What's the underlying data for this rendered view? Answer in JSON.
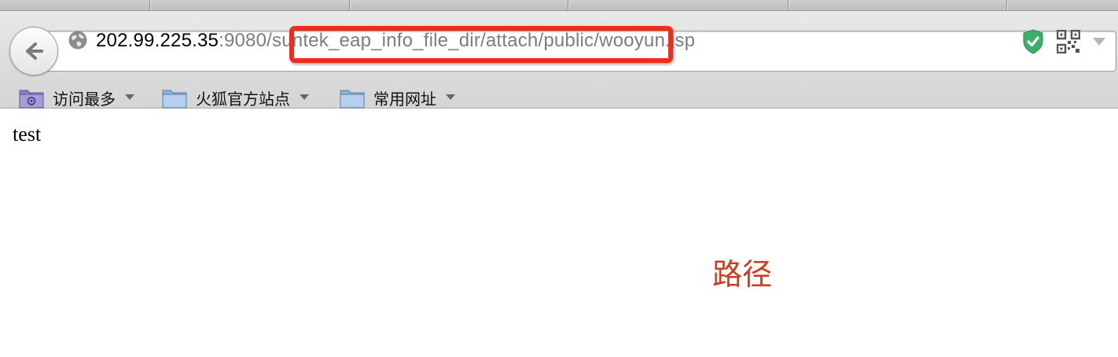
{
  "browser": {
    "url": {
      "host": "202.99.225.35",
      "rest": ":9080/suntek_eap_info_file_dir/attach/public/wooyun.jsp"
    },
    "bookmarks": [
      {
        "label": "访问最多",
        "icon": "smart-folder-icon"
      },
      {
        "label": "火狐官方站点",
        "icon": "folder-icon"
      },
      {
        "label": "常用网址",
        "icon": "folder-icon"
      }
    ],
    "icons": {
      "back": "back-arrow-icon",
      "site": "globe-icon",
      "security": "shield-check-icon",
      "qr": "qr-code-icon",
      "menu": "dropdown-triangle-icon"
    }
  },
  "page": {
    "body_text": "test"
  },
  "annotation": {
    "label": "路径",
    "color": "#ee2e1b"
  }
}
